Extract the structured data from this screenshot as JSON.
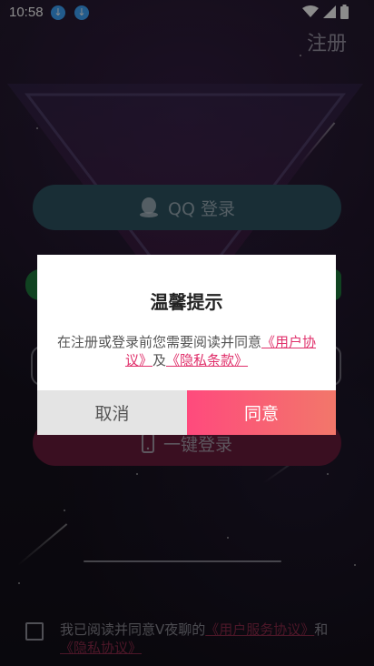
{
  "status_bar": {
    "time": "10:58",
    "icons": [
      "download-icon",
      "download-icon",
      "wifi-icon",
      "signal-icon",
      "battery-icon"
    ]
  },
  "header": {
    "register_label": "注册"
  },
  "login": {
    "qq_label": "QQ 登录",
    "phone_label": "一键登录"
  },
  "agreement": {
    "prefix": "我已阅读并同意V夜聊的",
    "service_link": "《用户服务协议》",
    "and": "和",
    "privacy_link": "《隐私协议》"
  },
  "dialog": {
    "title": "温馨提示",
    "body_prefix": "在注册或登录前您需要阅读并同意",
    "user_agreement": "《用户协议》",
    "and": "及",
    "privacy_terms": "《隐私条款》",
    "cancel_label": "取消",
    "agree_label": "同意"
  },
  "colors": {
    "accent": "#e0306b",
    "agree_gradient_start": "#ff4a7d",
    "agree_gradient_end": "#f2776a",
    "qq_button": "#2e5563",
    "phone_button": "#6b1d3c"
  }
}
